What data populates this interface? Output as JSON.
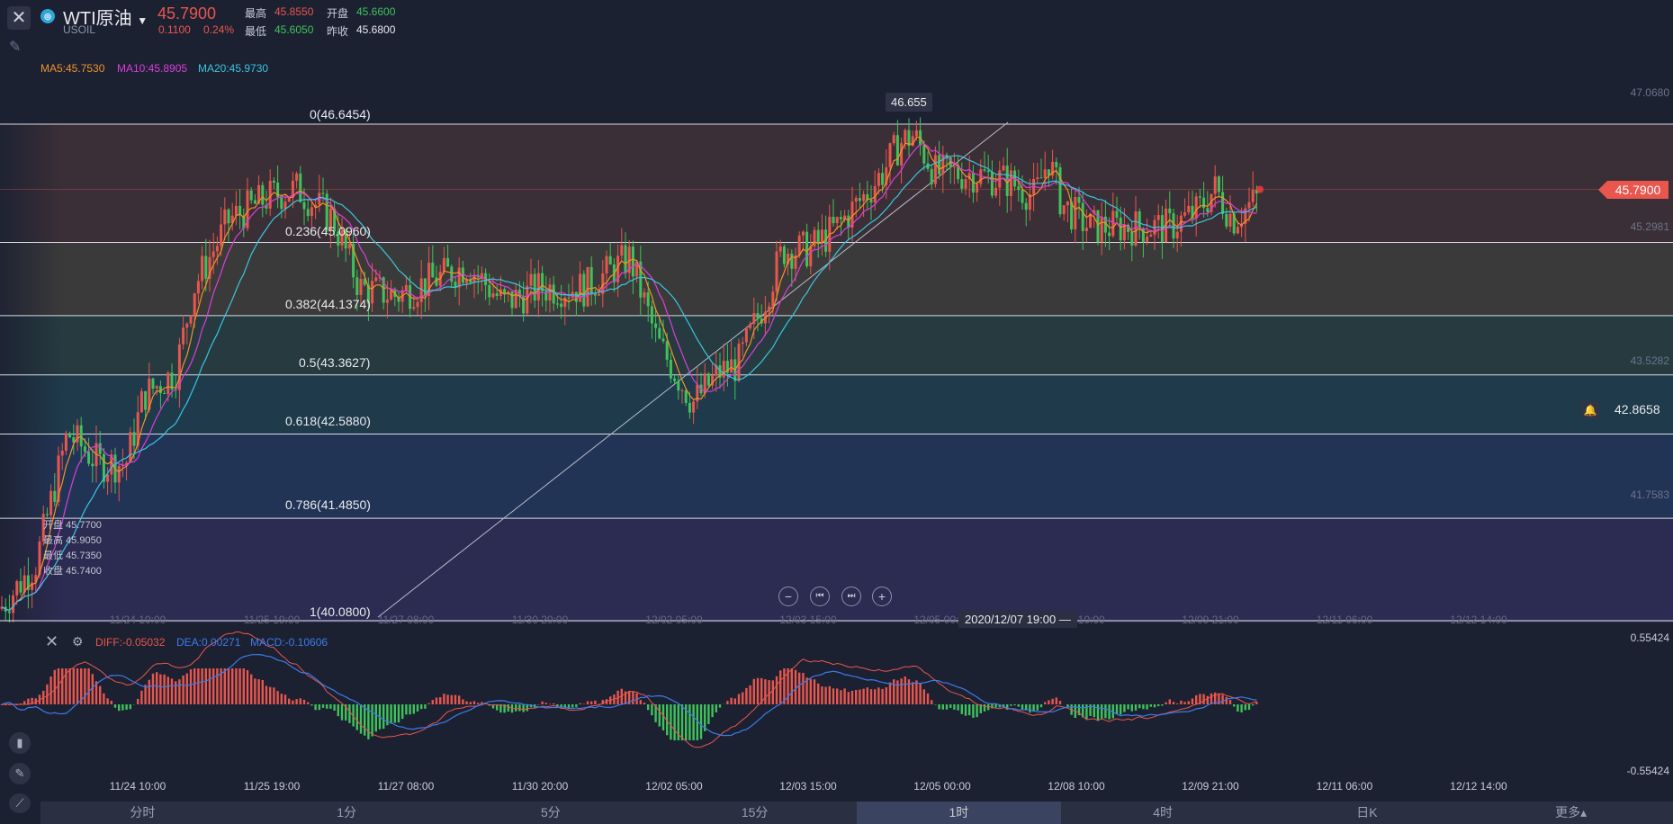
{
  "header": {
    "symbol_name": "WTI原油",
    "symbol_code": "USOIL",
    "price": "45.7900",
    "change": "0.1100",
    "change_pct": "0.24%",
    "high_label": "最高",
    "high": "45.8550",
    "open_label": "开盘",
    "open": "45.6600",
    "low_label": "最低",
    "low": "45.6050",
    "prev_label": "昨收",
    "prev": "45.6800",
    "colors": {
      "up": "#e8564d",
      "down": "#3fc25a",
      "accent": "#2ea6d8"
    }
  },
  "ma_legend": {
    "ma5": "MA5:45.7530",
    "ma10": "MA10:45.8905",
    "ma20": "MA20:45.9730"
  },
  "fib_levels": [
    {
      "label": "0(46.6454)",
      "value": 46.6454
    },
    {
      "label": "0.236(45.0960)",
      "value": 45.096
    },
    {
      "label": "0.382(44.1374)",
      "value": 44.1374
    },
    {
      "label": "0.5(43.3627)",
      "value": 43.3627
    },
    {
      "label": "0.618(42.5880)",
      "value": 42.588
    },
    {
      "label": "0.786(41.4850)",
      "value": 41.485
    },
    {
      "label": "1(40.0800)",
      "value": 40.08
    }
  ],
  "price_axis": [
    "47.0680",
    "45.2981",
    "43.5282",
    "41.7583"
  ],
  "current_price_tag": "45.7900",
  "alert_price": "42.8658",
  "peak_label": "46.655",
  "crosshair_ohlc": {
    "open": "开盘 45.7700",
    "high": "最高 45.9050",
    "low": "最低 45.7350",
    "close": "收盘 45.7400"
  },
  "x_axis_main": [
    "11/24 10:00",
    "11/25 19:00",
    "11/27 08:00",
    "11/30 20:00",
    "12/02 05:00",
    "12/03 15:00",
    "12/05 00:00",
    "12/08 10:00",
    "12/09 21:00",
    "12/11 06:00",
    "12/12 14:00"
  ],
  "x_axis_macd": [
    "11/24 10:00",
    "11/25 19:00",
    "11/27 08:00",
    "11/30 20:00",
    "12/02 05:00",
    "12/03 15:00",
    "12/05 00:00",
    "12/08 10:00",
    "12/09 21:00",
    "12/11 06:00",
    "12/12 14:00"
  ],
  "crosshair_time": "2020/12/07 19:00",
  "macd": {
    "diff": "DIFF:-0.05032",
    "dea": "DEA:0.00271",
    "macd": "MACD:-0.10606",
    "axis_top": "0.55424",
    "axis_bottom": "-0.55424"
  },
  "tabs": [
    {
      "label": "分时",
      "active": false
    },
    {
      "label": "1分",
      "active": false
    },
    {
      "label": "5分",
      "active": false
    },
    {
      "label": "15分",
      "active": false
    },
    {
      "label": "1时",
      "active": true
    },
    {
      "label": "4时",
      "active": false
    },
    {
      "label": "日K",
      "active": false
    },
    {
      "label": "更多▴",
      "active": false
    }
  ],
  "chart_data": {
    "type": "line",
    "title": "",
    "xlabel": "",
    "ylabel": "",
    "ylim": [
      40.0,
      47.1
    ],
    "price_anchors": [
      {
        "x": 0,
        "y": 40.3
      },
      {
        "x": 40,
        "y": 40.9
      },
      {
        "x": 75,
        "y": 42.6
      },
      {
        "x": 110,
        "y": 42.2
      },
      {
        "x": 140,
        "y": 42.2
      },
      {
        "x": 160,
        "y": 43.1
      },
      {
        "x": 195,
        "y": 43.4
      },
      {
        "x": 215,
        "y": 44.5
      },
      {
        "x": 255,
        "y": 45.4
      },
      {
        "x": 300,
        "y": 45.7
      },
      {
        "x": 330,
        "y": 45.8
      },
      {
        "x": 370,
        "y": 45.4
      },
      {
        "x": 400,
        "y": 44.5
      },
      {
        "x": 440,
        "y": 44.4
      },
      {
        "x": 480,
        "y": 44.6
      },
      {
        "x": 520,
        "y": 44.8
      },
      {
        "x": 560,
        "y": 44.3
      },
      {
        "x": 600,
        "y": 44.5
      },
      {
        "x": 650,
        "y": 44.5
      },
      {
        "x": 700,
        "y": 44.9
      },
      {
        "x": 730,
        "y": 43.8
      },
      {
        "x": 770,
        "y": 43.0
      },
      {
        "x": 800,
        "y": 43.4
      },
      {
        "x": 820,
        "y": 43.5
      },
      {
        "x": 845,
        "y": 44.2
      },
      {
        "x": 870,
        "y": 45.0
      },
      {
        "x": 900,
        "y": 45.0
      },
      {
        "x": 930,
        "y": 45.3
      },
      {
        "x": 960,
        "y": 45.7
      },
      {
        "x": 980,
        "y": 46.0
      },
      {
        "x": 1000,
        "y": 46.4
      },
      {
        "x": 1015,
        "y": 46.5
      },
      {
        "x": 1040,
        "y": 46.0
      },
      {
        "x": 1080,
        "y": 46.0
      },
      {
        "x": 1120,
        "y": 45.9
      },
      {
        "x": 1150,
        "y": 45.7
      },
      {
        "x": 1165,
        "y": 46.2
      },
      {
        "x": 1180,
        "y": 45.6
      },
      {
        "x": 1210,
        "y": 45.3
      },
      {
        "x": 1260,
        "y": 45.3
      },
      {
        "x": 1300,
        "y": 45.3
      },
      {
        "x": 1330,
        "y": 45.5
      },
      {
        "x": 1350,
        "y": 45.8
      },
      {
        "x": 1370,
        "y": 45.4
      },
      {
        "x": 1400,
        "y": 45.7
      }
    ],
    "series": [
      {
        "name": "MA5",
        "color": "#f0932b"
      },
      {
        "name": "MA10",
        "color": "#d93fd9"
      },
      {
        "name": "MA20",
        "color": "#39c6e0"
      }
    ]
  }
}
